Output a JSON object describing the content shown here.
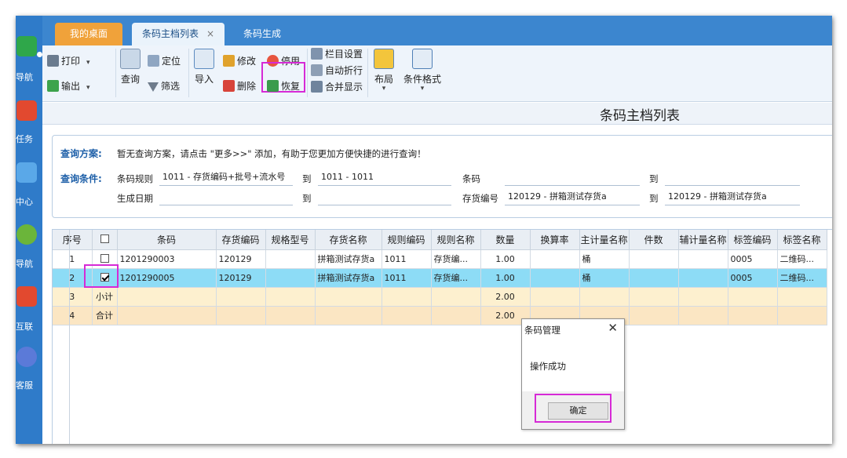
{
  "nav": {
    "items": [
      {
        "label": "导航",
        "icon": "navigation-icon",
        "color": "#2fa74a"
      },
      {
        "label": "任务",
        "icon": "task-icon",
        "color": "#e2492f"
      },
      {
        "label": "中心",
        "icon": "center-icon",
        "color": "#5aa8e8"
      },
      {
        "label": "导航",
        "icon": "compass-icon",
        "color": "#6bb53a"
      },
      {
        "label": "互联",
        "icon": "connect-icon",
        "color": "#e2492f"
      },
      {
        "label": "客服",
        "icon": "service-icon",
        "color": "#5b7ad8"
      }
    ]
  },
  "tabs": {
    "desktop": "我的桌面",
    "list": "条码主档列表",
    "list_close": "×",
    "generate": "条码生成"
  },
  "toolbar": {
    "print": "打印",
    "export": "输出",
    "query": "查询",
    "locate": "定位",
    "filter": "筛选",
    "import": "导入",
    "modify": "修改",
    "delete": "删除",
    "disable": "停用",
    "restore": "恢复",
    "column_settings": "栏目设置",
    "auto_wrap": "自动折行",
    "merge_display": "合并显示",
    "layout": "布局",
    "conditional_format": "条件格式"
  },
  "page": {
    "title": "条码主档列表"
  },
  "query": {
    "scheme_label": "查询方案:",
    "scheme_text": "暂无查询方案，请点击 \"更多>>\" 添加，有助于您更加方便快捷的进行查询！",
    "cond_label": "查询条件:",
    "rule_label": "条码规则",
    "rule_from": "1011 - 存货编码+批号+流水号",
    "to1": "到",
    "rule_to": "1011 - 1011",
    "barcode_label": "条码",
    "barcode_from": "",
    "to2": "到",
    "barcode_to": "",
    "date_label": "生成日期",
    "date_from": "",
    "to3": "到",
    "date_to": "",
    "inv_label": "存货编号",
    "inv_from": "120129 - 拼箱测试存货a",
    "to4": "到",
    "inv_to": "120129 - 拼箱测试存货a"
  },
  "grid": {
    "columns": [
      "序号",
      "",
      "条码",
      "存货编码",
      "规格型号",
      "存货名称",
      "规则编码",
      "规则名称",
      "数量",
      "换算率",
      "主计量名称",
      "件数",
      "辅计量名称",
      "标签编码",
      "标签名称"
    ],
    "rows": [
      {
        "no": "1",
        "checked": false,
        "barcode": "1201290003",
        "inv_code": "120129",
        "spec": "",
        "inv_name": "拼箱测试存货a",
        "rule_code": "1011",
        "rule_name": "存货编...",
        "qty": "1.00",
        "rate": "",
        "unit": "桶",
        "pieces": "",
        "aux_unit": "",
        "label_code": "0005",
        "label_name": "二维码..."
      },
      {
        "no": "2",
        "checked": true,
        "barcode": "1201290005",
        "inv_code": "120129",
        "spec": "",
        "inv_name": "拼箱测试存货a",
        "rule_code": "1011",
        "rule_name": "存货编...",
        "qty": "1.00",
        "rate": "",
        "unit": "桶",
        "pieces": "",
        "aux_unit": "",
        "label_code": "0005",
        "label_name": "二维码..."
      }
    ],
    "subtotal": {
      "no": "3",
      "label": "小计",
      "qty": "2.00"
    },
    "total": {
      "no": "4",
      "label": "合计",
      "qty": "2.00"
    }
  },
  "dialog": {
    "title": "条码管理",
    "close": "✕",
    "message": "操作成功",
    "ok": "确定"
  },
  "colors": {
    "highlight": "#d62ad6",
    "selected_row": "#8ddcf6",
    "tab_orange": "#f0a23a",
    "nav_blue": "#2f7bc9"
  }
}
